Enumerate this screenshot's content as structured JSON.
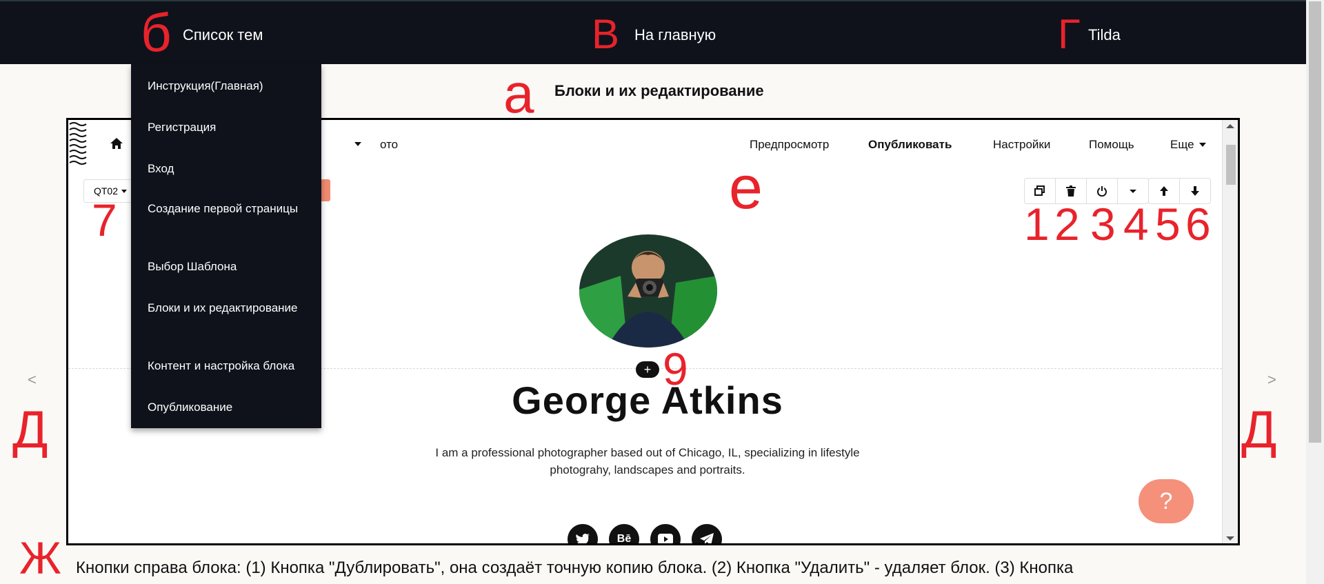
{
  "topbar": {
    "items": [
      {
        "label": "Список тем",
        "marker": "б"
      },
      {
        "label": "На главную",
        "marker": "В"
      },
      {
        "label": "Tilda",
        "marker": "Г"
      }
    ]
  },
  "dropdown": {
    "items": [
      "Инструкция(Главная)",
      "Регистрация",
      "Вход",
      "Создание первой страницы",
      "Выбор Шаблона",
      "Блоки и их редактирование",
      "Контент и настройка блока",
      "Опубликование"
    ]
  },
  "page": {
    "title": "Блоки и их редактирование",
    "title_marker": "а"
  },
  "editor": {
    "nav_partial": "ото",
    "nav_links": [
      "Предпросмотр",
      "Опубликовать",
      "Настройки",
      "Помощь",
      "Еще"
    ],
    "block_code": "QT02",
    "markers": {
      "e": "е",
      "seven": "7",
      "nine": "9",
      "numbers": [
        "1",
        "2",
        "3",
        "4",
        "5",
        "6"
      ]
    }
  },
  "profile": {
    "name": "George Atkins",
    "bio_line1": "I am a professional photographer based out of Chicago, IL, specializing in lifestyle",
    "bio_line2": "photograhy, landscapes and portraits.",
    "social": [
      "twitter-icon",
      "behance-icon",
      "youtube-icon",
      "telegram-icon"
    ]
  },
  "help_label": "?",
  "side_markers": {
    "left": "Д",
    "right": "Д"
  },
  "side_arrows": {
    "left": "<",
    "right": ">"
  },
  "bottom": {
    "marker": "Ж",
    "text": "Кнопки справа блока: (1) Кнопка \"Дублировать\", она создаёт точную копию блока. (2) Кнопка \"Удалить\" - удаляет блок. (3) Кнопка"
  },
  "colors": {
    "accent_red": "#e8232b",
    "dark_bg": "#0f121b",
    "help_orange": "#f5907b"
  }
}
